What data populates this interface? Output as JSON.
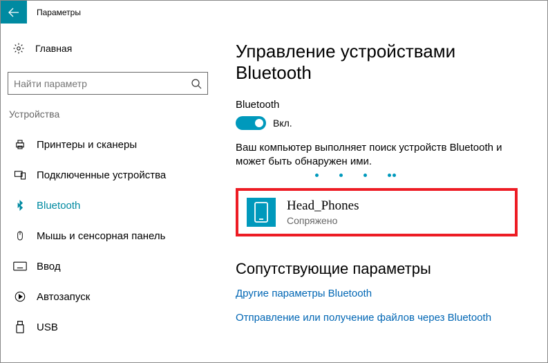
{
  "titlebar": {
    "title": "Параметры"
  },
  "sidebar": {
    "home": "Главная",
    "search_placeholder": "Найти параметр",
    "category": "Устройства",
    "items": [
      {
        "label": "Принтеры и сканеры"
      },
      {
        "label": "Подключенные устройства"
      },
      {
        "label": "Bluetooth"
      },
      {
        "label": "Мышь и сенсорная панель"
      },
      {
        "label": "Ввод"
      },
      {
        "label": "Автозапуск"
      },
      {
        "label": "USB"
      }
    ]
  },
  "main": {
    "heading": "Управление устройствами Bluetooth",
    "bt_label": "Bluetooth",
    "toggle_state": "Вкл.",
    "bt_desc": "Ваш компьютер выполняет поиск устройств Bluetooth и может быть обнаружен ими.",
    "device": {
      "name": "Head_Phones",
      "status": "Сопряжено"
    },
    "related_heading": "Сопутствующие параметры",
    "links": [
      "Другие параметры Bluetooth",
      "Отправление или получение файлов через Bluetooth"
    ]
  }
}
